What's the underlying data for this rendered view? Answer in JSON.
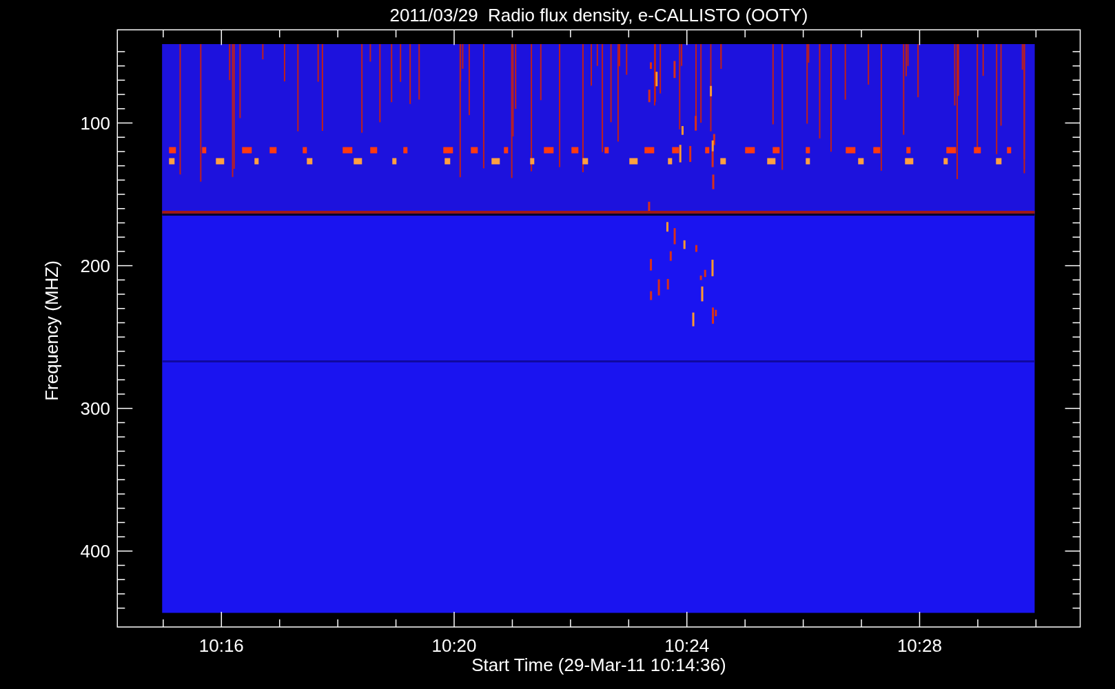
{
  "title": "2011/03/29  Radio flux density, e-CALLISTO (OOTY)",
  "y_axis": {
    "label": "Frequency (MHZ)",
    "ticks": [
      "100",
      "200",
      "300",
      "400"
    ]
  },
  "x_axis": {
    "label": "Start Time (29-Mar-11 10:14:36)",
    "ticks": [
      "10:16",
      "10:20",
      "10:24",
      "10:28"
    ]
  }
}
